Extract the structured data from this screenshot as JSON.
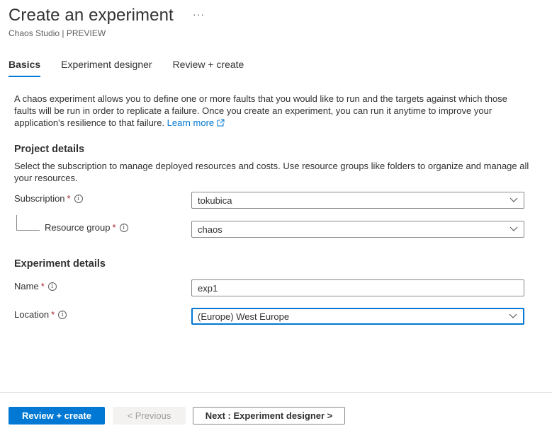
{
  "header": {
    "title": "Create an experiment",
    "more": "···",
    "subtitle": "Chaos Studio | PREVIEW"
  },
  "tabs": [
    {
      "label": "Basics",
      "active": true
    },
    {
      "label": "Experiment designer",
      "active": false
    },
    {
      "label": "Review + create",
      "active": false
    }
  ],
  "intro": {
    "text": "A chaos experiment allows you to define one or more faults that you would like to run and the targets against which those faults will be run in order to replicate a failure. Once you create an experiment, you can run it anytime to improve your application's resilience to that failure. ",
    "link": "Learn more"
  },
  "project": {
    "heading": "Project details",
    "description": "Select the subscription to manage deployed resources and costs. Use resource groups like folders to organize and manage all your resources.",
    "subscription": {
      "label": "Subscription",
      "required": "*",
      "value": "tokubica"
    },
    "resource_group": {
      "label": "Resource group",
      "required": "*",
      "value": "chaos"
    }
  },
  "experiment": {
    "heading": "Experiment details",
    "name": {
      "label": "Name",
      "required": "*",
      "value": "exp1"
    },
    "location": {
      "label": "Location",
      "required": "*",
      "value": "(Europe) West Europe"
    }
  },
  "footer": {
    "review_create": "Review + create",
    "previous": "< Previous",
    "next": "Next : Experiment designer >"
  },
  "colors": {
    "accent": "#0078d4",
    "required": "#a4262c",
    "text": "#323130"
  },
  "icons": [
    "more-icon",
    "external-link-icon",
    "info-icon",
    "chevron-down-icon"
  ]
}
